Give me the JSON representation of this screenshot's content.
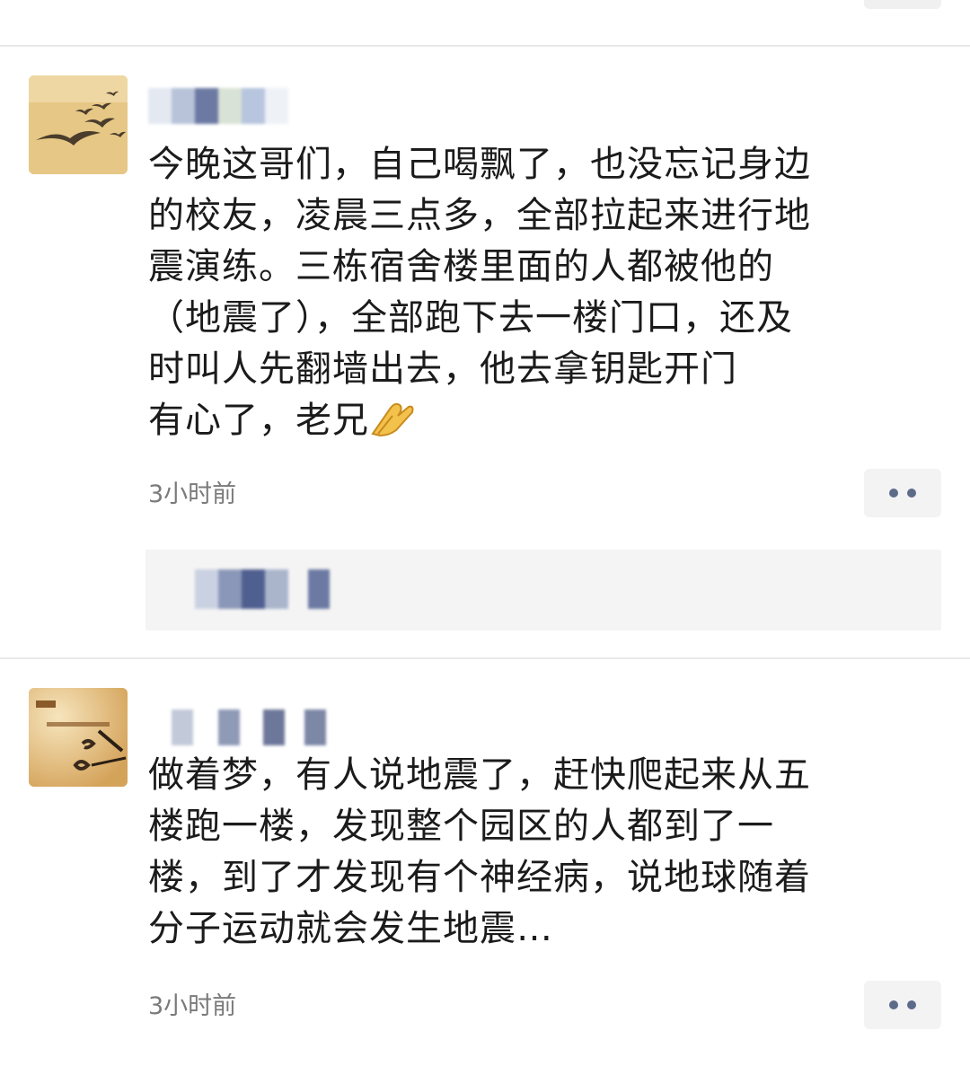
{
  "posts": [
    {
      "text_lines": [
        "今晚这哥们，自己喝飘了，也没忘记身边",
        "的校友，凌晨三点多，全部拉起来进行地",
        "震演练。三栋宿舍楼里面的人都被他的",
        "（地震了），全部跑下去一楼门口，还及",
        "时叫人先翻墙出去，他去拿钥匙开门",
        "有心了，老兄"
      ],
      "trailing_emoji": "pray-hands-emoji",
      "time": "3小时前",
      "avatar": "birds-flying-avatar"
    },
    {
      "text_lines": [
        "做着梦，有人说地震了，赶快爬起来从五",
        "楼跑一楼，发现整个园区的人都到了一",
        "楼，到了才发现有个神经病，说地球随着",
        "分子运动就会发生地震…"
      ],
      "time": "3小时前",
      "avatar": "time-clock-avatar"
    }
  ],
  "colors": {
    "more_dots": "#5d6a8a",
    "time_text": "#7a7a7a",
    "likes_bg": "#f4f4f4"
  }
}
